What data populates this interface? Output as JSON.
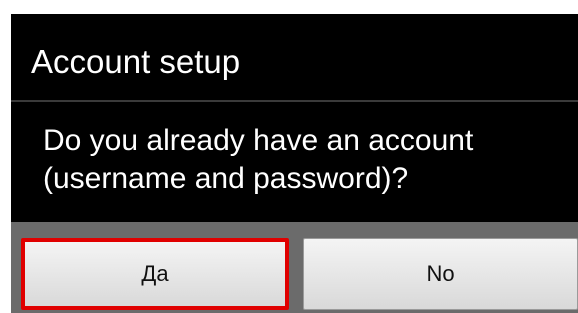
{
  "dialog": {
    "title": "Account setup",
    "message": "Do you already have an account (username and password)?",
    "buttons": {
      "yes_label": "Да",
      "no_label": "No"
    },
    "highlight_color": "#e00000"
  }
}
